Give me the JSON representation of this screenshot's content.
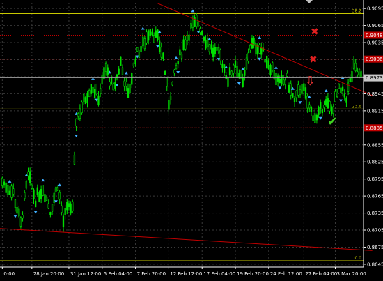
{
  "chart_data": {
    "type": "candlestick",
    "symbol": "",
    "y_ticks": [
      "0.9095",
      "0.9065",
      "0.9035",
      "0.9005",
      "0.8975",
      "0.8945",
      "0.8915",
      "0.8885",
      "0.8855",
      "0.8825",
      "0.8795",
      "0.8765",
      "0.8735",
      "0.8705",
      "0.8675",
      "0.8645"
    ],
    "ylim": [
      0.864,
      0.9105
    ],
    "x_ticks": [
      {
        "label": "0:00",
        "i": 0
      },
      {
        "label": "28 Jan 20:00",
        "i": 16
      },
      {
        "label": "31 Jan 12:00",
        "i": 36
      },
      {
        "label": "5 Feb 04:00",
        "i": 54
      },
      {
        "label": "7 Feb 20:00",
        "i": 72
      },
      {
        "label": "12 Feb 12:00",
        "i": 90
      },
      {
        "label": "17 Feb 04:00",
        "i": 108
      },
      {
        "label": "19 Feb 20:00",
        "i": 126
      },
      {
        "label": "24 Feb 12:00",
        "i": 144
      },
      {
        "label": "27 Feb 04:00",
        "i": 163
      },
      {
        "label": "3 Mar 20:00",
        "i": 180
      }
    ],
    "candle_count": 195,
    "trendlines": [
      {
        "from": [
          84,
          0.9104
        ],
        "to": [
          200,
          0.8942
        ],
        "color": "#c00000"
      },
      {
        "from": [
          -2,
          0.8708
        ],
        "to": [
          200,
          0.8669
        ],
        "color": "#c00000"
      }
    ],
    "fib_levels": [
      {
        "label": "38.2",
        "value": 0.9086,
        "color": "#c8c800"
      },
      {
        "label": "23.6",
        "value": 0.8918,
        "color": "#c8c800"
      },
      {
        "label": "0.0",
        "value": 0.8651,
        "color": "#c8c800"
      }
    ],
    "red_levels": [
      {
        "label": "0.9048",
        "value": 0.9048
      },
      {
        "label": "0.9006",
        "value": 0.9006
      },
      {
        "label": "0.8885",
        "value": 0.8885
      }
    ],
    "current_price": {
      "label": "0.8973",
      "value": 0.8973
    },
    "colors": {
      "background": "#000000",
      "bull": "#00e000",
      "bear": "#00a000",
      "fractal": "#40b0ff",
      "grid": "#3a3a3a",
      "axis_text": "#ffffff",
      "red_level": "#c00000",
      "fib": "#c8c800",
      "price": "#a0a0a0"
    }
  },
  "markers": {
    "cross": "✖",
    "check": "✔",
    "arrow_down": "⇩"
  }
}
